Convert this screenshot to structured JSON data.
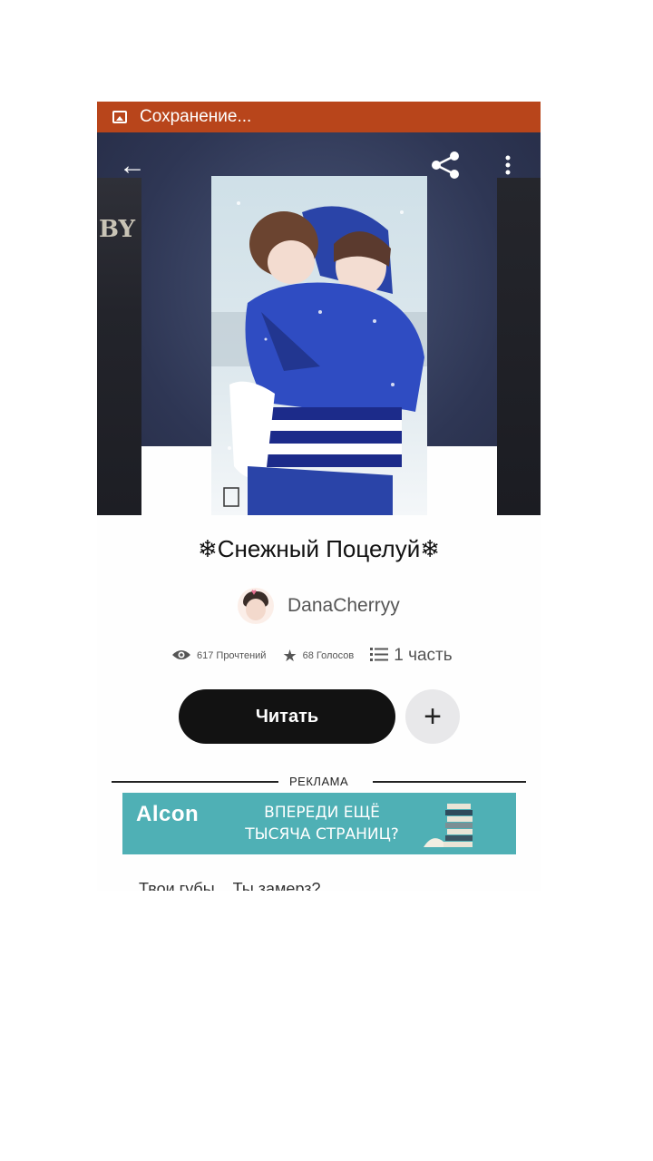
{
  "statusbar": {
    "text": "Сохранение..."
  },
  "toolbar": {
    "back_icon": "arrow-left-icon",
    "share_icon": "share-icon",
    "more_icon": "more-vert-icon"
  },
  "side_cover_left": {
    "text": "BY"
  },
  "story": {
    "title": "❄Снежный Поцелуй❄",
    "author": "DanaCherryy",
    "reads": "617 Прочтений",
    "votes": "68 Голосов",
    "parts": "1 часть"
  },
  "actions": {
    "read_label": "Читать",
    "add_label": "+"
  },
  "ad": {
    "label": "РЕКЛАМА",
    "brand": "Alcon",
    "text_line1": "ВПЕРЕДИ ЕЩЁ",
    "text_line2": "ТЫСЯЧА СТРАНИЦ?",
    "color": "#4fb0b5"
  },
  "excerpt": "Твои губы... Ты замерз?",
  "colors": {
    "status_bar": "#b8451b",
    "hero": "#2e3654",
    "read_button": "#121212"
  }
}
